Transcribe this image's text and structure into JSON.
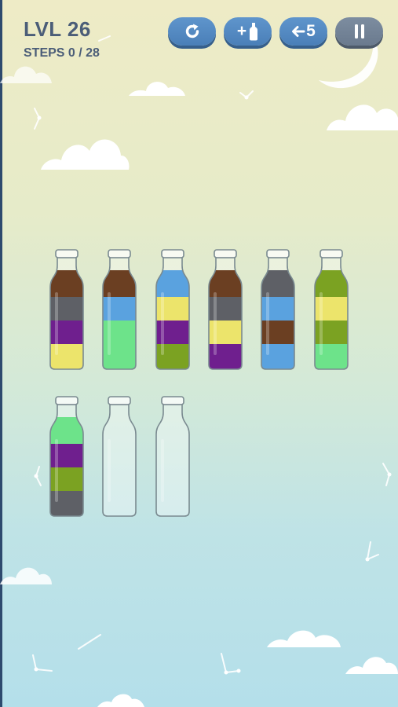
{
  "hud": {
    "level_label": "LVL 26",
    "steps_label": "STEPS 0 / 28"
  },
  "toolbar": {
    "restart": {
      "icon": "restart-icon"
    },
    "add_bottle": {
      "label": "+",
      "icon": "bottle-icon"
    },
    "undo": {
      "label": "5",
      "icon": "back-arrow-icon"
    },
    "pause": {
      "icon": "pause-icon"
    }
  },
  "colors": {
    "brown": "#6b3f22",
    "gray": "#5e6066",
    "purple": "#6f1f8e",
    "yellow": "#ece46b",
    "blue": "#5aa2df",
    "green": "#6de38a",
    "olive": "#7ba222"
  },
  "bottles": [
    {
      "layers": [
        "yellow",
        "purple",
        "gray",
        "brown"
      ]
    },
    {
      "layers": [
        "green",
        "green",
        "blue",
        "brown"
      ]
    },
    {
      "layers": [
        "olive",
        "purple",
        "yellow",
        "blue"
      ]
    },
    {
      "layers": [
        "purple",
        "yellow",
        "gray",
        "brown"
      ]
    },
    {
      "layers": [
        "blue",
        "brown",
        "blue",
        "gray"
      ]
    },
    {
      "layers": [
        "green",
        "olive",
        "yellow",
        "olive"
      ]
    },
    {
      "layers": [
        "gray",
        "olive",
        "purple",
        "green"
      ]
    },
    {
      "layers": []
    },
    {
      "layers": []
    }
  ]
}
